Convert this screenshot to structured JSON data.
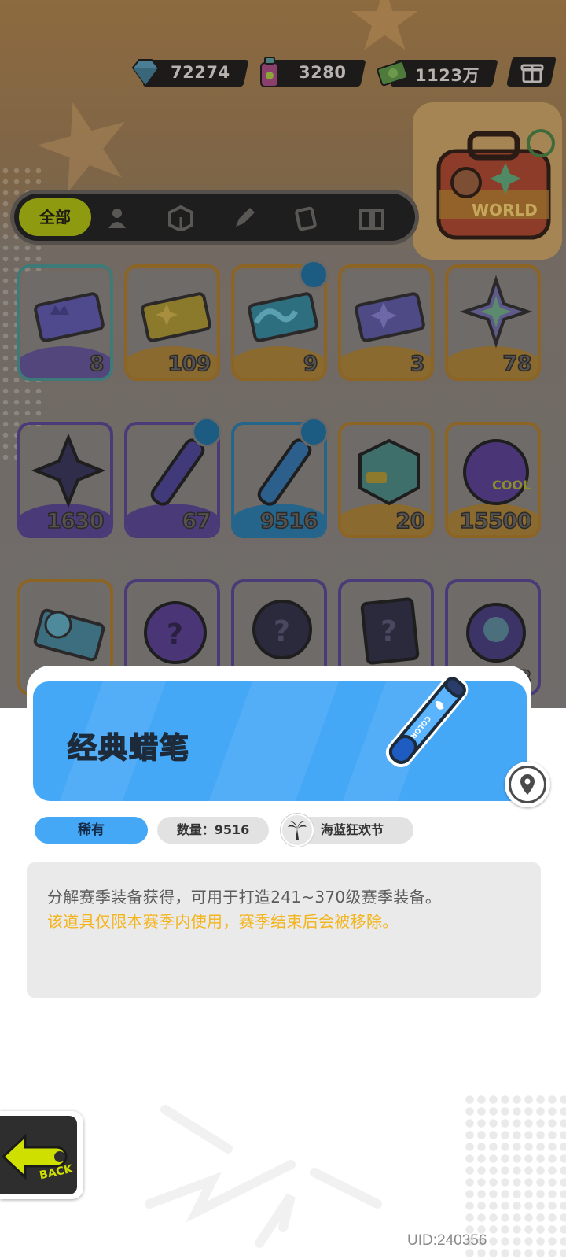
{
  "currencies": [
    {
      "name": "diamond-icon",
      "value": "72274"
    },
    {
      "name": "spray-can-icon",
      "value": "3280"
    },
    {
      "name": "cash-icon",
      "value": "1123万"
    }
  ],
  "tabs": {
    "active_label": "全部",
    "icons": [
      "person-icon",
      "box-icon",
      "pen-icon",
      "card-icon",
      "book-icon"
    ]
  },
  "grid": {
    "rows": [
      [
        {
          "count": "8",
          "rarity": "teal",
          "icon": "purple-ticket-icon"
        },
        {
          "count": "109",
          "rarity": "orange",
          "icon": "gold-ticket-icon"
        },
        {
          "count": "9",
          "rarity": "orange",
          "icon": "wave-ticket-icon",
          "tagged": true
        },
        {
          "count": "3",
          "rarity": "orange",
          "icon": "star-ticket-icon"
        },
        {
          "count": "78",
          "rarity": "orange",
          "icon": "rainbow-star-icon"
        }
      ],
      [
        {
          "count": "1630",
          "rarity": "purple",
          "icon": "dark-star-icon"
        },
        {
          "count": "67",
          "rarity": "purple",
          "icon": "purple-crayon-icon",
          "tagged": true
        },
        {
          "count": "9516",
          "rarity": "blue",
          "icon": "blue-crayon-icon",
          "tagged": true
        },
        {
          "count": "20",
          "rarity": "orange",
          "icon": "cube-icon"
        },
        {
          "count": "15500",
          "rarity": "orange",
          "icon": "cool-sphere-icon"
        }
      ],
      [
        {
          "count": "",
          "rarity": "orange",
          "icon": "fish-ticket-icon"
        },
        {
          "count": "",
          "rarity": "purple",
          "icon": "mystery-egg-icon"
        },
        {
          "count": "",
          "rarity": "purple",
          "icon": "mystery-deity-icon"
        },
        {
          "count": "",
          "rarity": "purple",
          "icon": "mystery-card-icon"
        },
        {
          "count": "3",
          "rarity": "purple",
          "icon": "fish-orb-icon"
        }
      ]
    ]
  },
  "detail": {
    "title": "经典蜡笔",
    "rarity": "稀有",
    "quantity": "数量：9516",
    "event": "海蓝狂欢节",
    "description": "分解赛季装备获得，可用于打造241~370级赛季装备。",
    "warning": "该道具仅限本赛季内使用，赛季结束后会被移除。"
  },
  "back_label": "BACK",
  "uid": "UID:240356",
  "colors": {
    "accent_blue": "#45a8f7",
    "warning_yellow": "#f4b41c",
    "tab_active": "#8e9a10"
  }
}
